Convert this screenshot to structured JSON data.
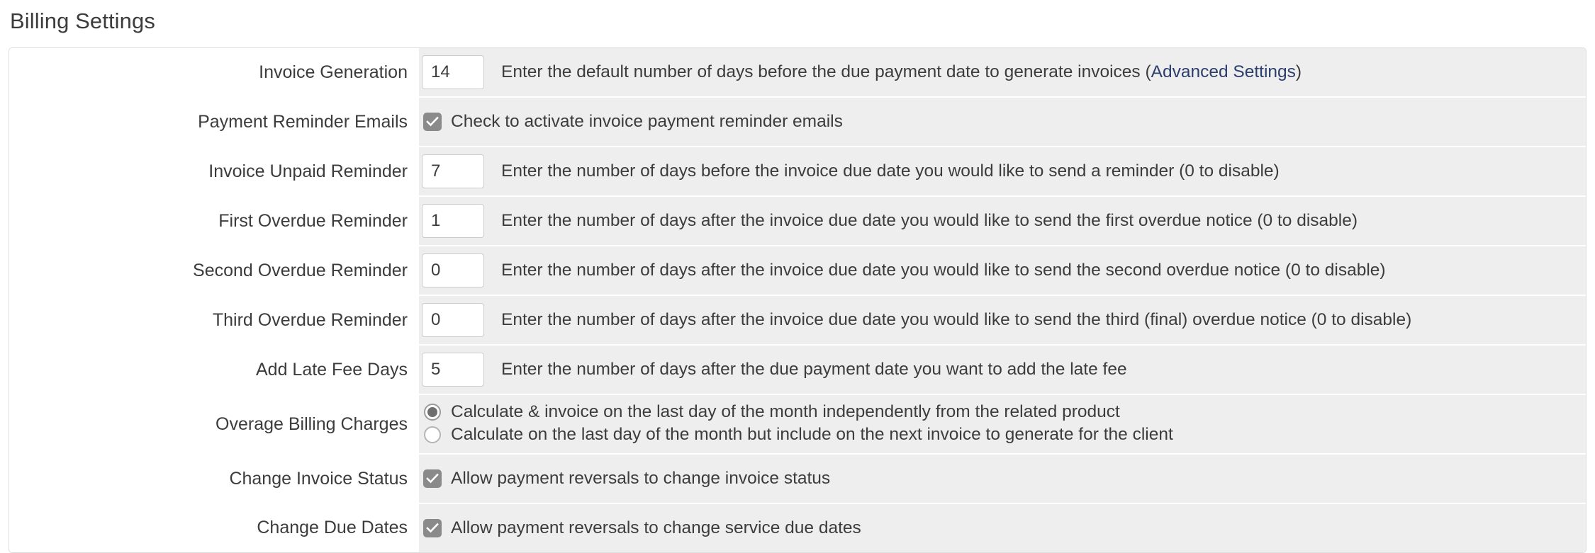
{
  "page": {
    "title": "Billing Settings"
  },
  "colors": {
    "link": "#2c3e6b",
    "row_background": "#eeeeee",
    "label_text": "#3c3c3c",
    "control_gray": "#8a8a8a",
    "panel_border": "#dddddd"
  },
  "rows": [
    {
      "id": "invoice-generation",
      "type": "number",
      "label": "Invoice Generation",
      "value": "14",
      "desc_before": "Enter the default number of days before the due payment date to generate invoices (",
      "link": "Advanced Settings",
      "desc_after": ")"
    },
    {
      "id": "payment-reminder-emails",
      "type": "checkbox",
      "label": "Payment Reminder Emails",
      "checked": true,
      "desc": "Check to activate invoice payment reminder emails"
    },
    {
      "id": "invoice-unpaid-reminder",
      "type": "number",
      "label": "Invoice Unpaid Reminder",
      "value": "7",
      "desc": "Enter the number of days before the invoice due date you would like to send a reminder (0 to disable)"
    },
    {
      "id": "first-overdue-reminder",
      "type": "number",
      "label": "First Overdue Reminder",
      "value": "1",
      "desc": "Enter the number of days after the invoice due date you would like to send the first overdue notice (0 to disable)"
    },
    {
      "id": "second-overdue-reminder",
      "type": "number",
      "label": "Second Overdue Reminder",
      "value": "0",
      "desc": "Enter the number of days after the invoice due date you would like to send the second overdue notice (0 to disable)"
    },
    {
      "id": "third-overdue-reminder",
      "type": "number",
      "label": "Third Overdue Reminder",
      "value": "0",
      "desc": "Enter the number of days after the invoice due date you would like to send the third (final) overdue notice (0 to disable)"
    },
    {
      "id": "add-late-fee-days",
      "type": "number",
      "label": "Add Late Fee Days",
      "value": "5",
      "desc": "Enter the number of days after the due payment date you want to add the late fee"
    },
    {
      "id": "overage-billing-charges",
      "type": "radio",
      "label": "Overage Billing Charges",
      "options": [
        {
          "label": "Calculate & invoice on the last day of the month independently from the related product",
          "selected": true
        },
        {
          "label": "Calculate on the last day of the month but include on the next invoice to generate for the client",
          "selected": false
        }
      ]
    },
    {
      "id": "change-invoice-status",
      "type": "checkbox",
      "label": "Change Invoice Status",
      "checked": true,
      "desc": "Allow payment reversals to change invoice status"
    },
    {
      "id": "change-due-dates",
      "type": "checkbox",
      "label": "Change Due Dates",
      "checked": true,
      "desc": "Allow payment reversals to change service due dates"
    }
  ]
}
